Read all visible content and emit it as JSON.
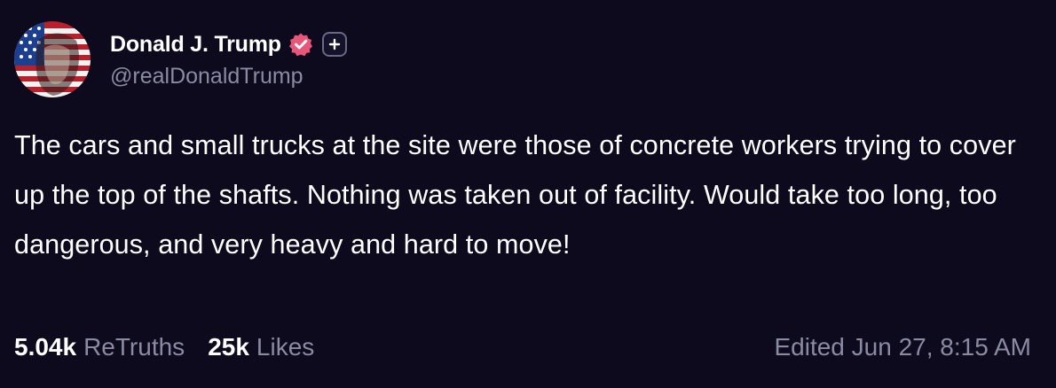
{
  "post": {
    "author": {
      "display_name": "Donald J. Trump",
      "handle": "@realDonaldTrump",
      "verified_icon": "verified-badge-icon",
      "plus_icon": "plus-badge-icon",
      "avatar_icon": "flag-portrait-avatar"
    },
    "text": "The cars and small trucks at the site were those of concrete workers trying to cover up the top of the shafts. Nothing was taken out of facility. Would take too long, too dangerous, and very heavy and hard to move!",
    "stats": {
      "retruths_count": "5.04k",
      "retruths_label": "ReTruths",
      "likes_count": "25k",
      "likes_label": "Likes"
    },
    "edited": "Edited Jun 27, 8:15 AM"
  },
  "colors": {
    "background": "#0c0a1c",
    "primary_text": "#ffffff",
    "secondary_text": "#8b8aa3",
    "verified_badge": "#e8567a"
  }
}
